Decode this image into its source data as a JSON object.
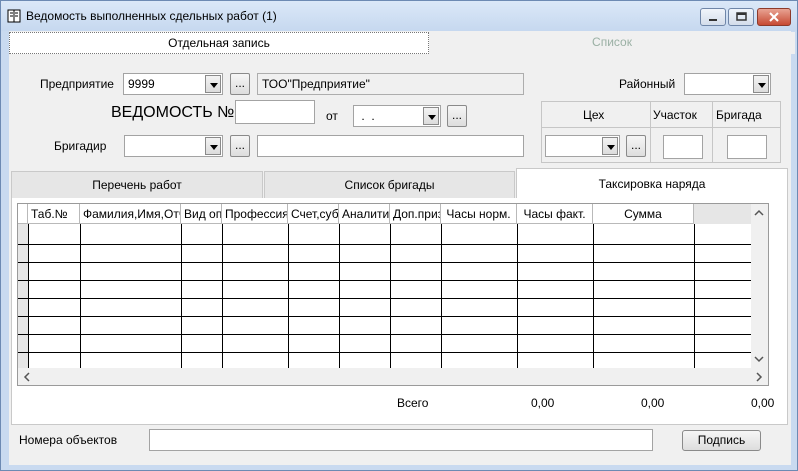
{
  "window": {
    "title": "Ведомость выполненных сдельных работ (1)"
  },
  "top_tabs": [
    {
      "label": "Отдельная запись",
      "active": true
    },
    {
      "label": "Список",
      "active": false
    }
  ],
  "form": {
    "enterprise_label": "Предприятие",
    "enterprise_code": "9999",
    "enterprise_name": "ТОО\"Предприятие\"",
    "district_label": "Районный",
    "district_value": "",
    "statement_label": "ВЕДОМОСТЬ №",
    "statement_number": "",
    "from_label": "от",
    "date_value": " .  .",
    "foreman_label": "Бригадир",
    "foreman_value": "",
    "foreman_name": "",
    "workshop_label": "Цех",
    "section_label": "Участок",
    "brigade_label": "Бригада",
    "dots_label": "..."
  },
  "sub_tabs": [
    {
      "label": "Перечень работ",
      "active": false
    },
    {
      "label": "Список бригады",
      "active": false
    },
    {
      "label": "Таксировка наряда",
      "active": true
    }
  ],
  "grid": {
    "columns": [
      "Таб.№",
      "Фамилия,Имя,Отчество",
      "Вид оплаты",
      "Профессия",
      "Счет,субсчет",
      "Аналитика",
      "Доп.признак",
      "Часы норм.",
      "Часы факт.",
      "Сумма"
    ]
  },
  "totals": {
    "label": "Всего",
    "values": [
      "0,00",
      "0,00",
      "0,00"
    ]
  },
  "footer": {
    "objects_label": "Номера объектов",
    "objects_value": "",
    "sign_button": "Подпись"
  },
  "colors": {
    "title_bg": "#c9daf0",
    "client_bg": "#f0f0f0",
    "inactive_tab_text": "#9ab0a4"
  },
  "icons": [
    "book-icon",
    "minimize-icon",
    "maximize-icon",
    "close-icon",
    "chevron-down-icon",
    "arrow-up-icon",
    "arrow-down-icon",
    "arrow-left-icon",
    "arrow-right-icon"
  ]
}
